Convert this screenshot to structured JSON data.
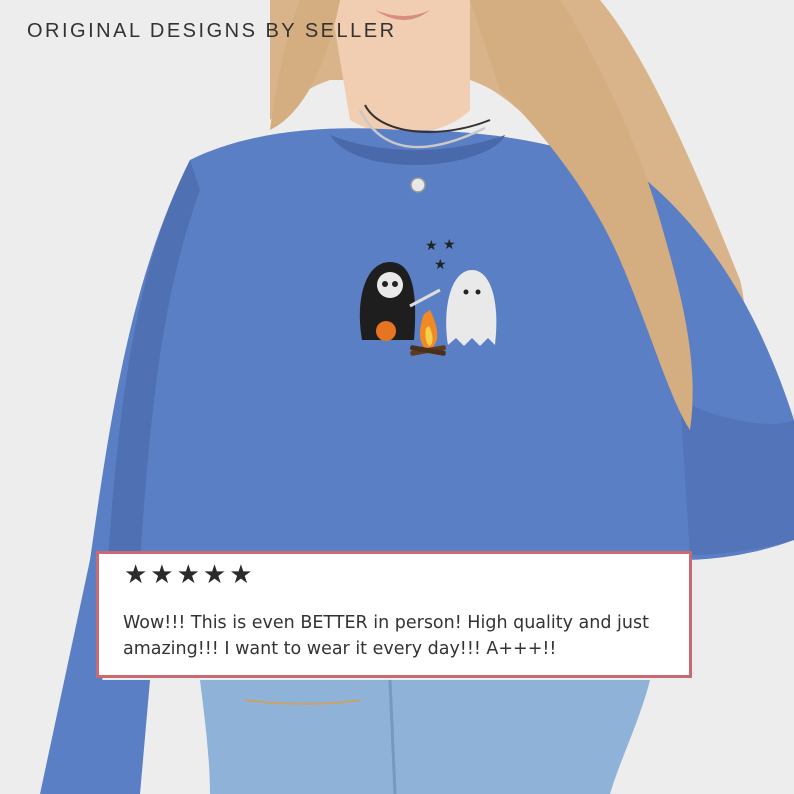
{
  "banner": {
    "text": "ORIGINAL DESIGNS BY SELLER"
  },
  "review": {
    "stars": "★★★★★",
    "rating": 5,
    "text": "Wow!!! This is even BETTER in person! High quality and just amazing!!! I want to wear it every day!!! A+++!!"
  },
  "colors": {
    "shirt": "#5b7fc4",
    "border": "#c86a72",
    "hair": "#d9b48a",
    "jeans": "#8fb2d8"
  }
}
